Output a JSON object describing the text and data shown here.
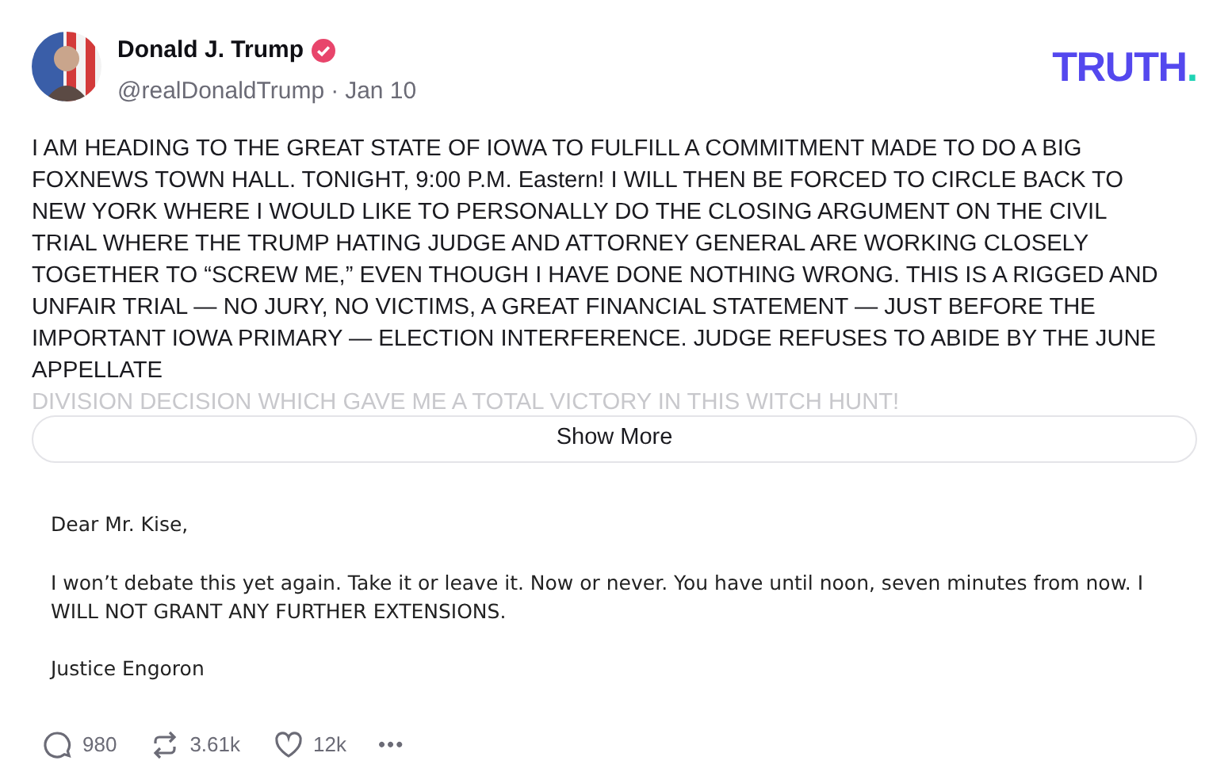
{
  "post": {
    "author": "Donald J. Trump",
    "verified": true,
    "handle": "@realDonaldTrump",
    "separator": "·",
    "date": "Jan 10",
    "logo": {
      "word": "TRUTH",
      "dot": "."
    },
    "body": "I AM HEADING TO THE GREAT STATE OF IOWA TO FULFILL A COMMITMENT MADE TO DO A BIG FOXNEWS TOWN HALL. TONIGHT, 9:00 P.M. Eastern! I WILL THEN BE FORCED TO CIRCLE BACK TO NEW YORK WHERE I WOULD LIKE TO PERSONALLY DO THE CLOSING ARGUMENT ON THE CIVIL TRIAL WHERE THE TRUMP HATING JUDGE AND ATTORNEY GENERAL ARE WORKING CLOSELY TOGETHER TO “SCREW ME,” EVEN THOUGH I HAVE DONE NOTHING WRONG. THIS IS A RIGGED AND UNFAIR TRIAL — NO JURY, NO VICTIMS, A GREAT FINANCIAL STATEMENT — JUST BEFORE THE IMPORTANT IOWA PRIMARY — ELECTION INTERFERENCE. JUDGE REFUSES TO ABIDE BY THE JUNE APPELLATE",
    "body_faded": "DIVISION DECISION WHICH GAVE ME A TOTAL VICTORY IN THIS WITCH HUNT!",
    "show_more": "Show More",
    "attachment": {
      "greeting": "Dear Mr. Kise,",
      "message": "I won’t debate this yet again.  Take it or leave it.  Now or never.  You have until noon, seven minutes from now.  I WILL NOT GRANT ANY FURTHER EXTENSIONS.",
      "signature": "Justice Engoron"
    },
    "actions": [
      {
        "kind": "reply",
        "count": "980"
      },
      {
        "kind": "repost",
        "count": "3.61k"
      },
      {
        "kind": "like",
        "count": "12k"
      },
      {
        "kind": "more",
        "count": "•••"
      }
    ]
  }
}
